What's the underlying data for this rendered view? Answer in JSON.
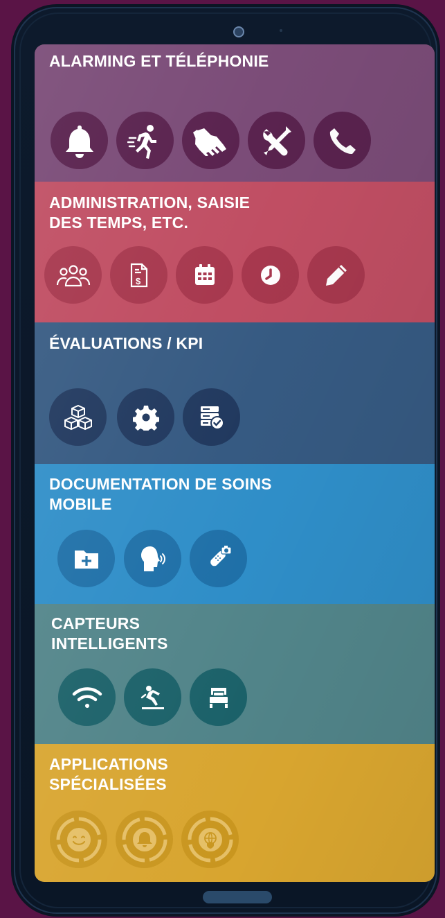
{
  "colors": {
    "background": "#5a1446",
    "alarming": "#7b4c78",
    "administration": "#c04e63",
    "evaluations": "#365a82",
    "documentation": "#2f8ec8",
    "capteurs": "#518489",
    "applications": "#d8a52f"
  },
  "sections": [
    {
      "id": "alarming",
      "title": "ALARMING ET TÉLÉPHONIE",
      "icons": [
        "bell-icon",
        "running-person-icon",
        "handshake-icon",
        "tools-icon",
        "phone-icon"
      ]
    },
    {
      "id": "administration",
      "title": "ADMINISTRATION, SAISIE\nDES TEMPS, ETC.",
      "icons": [
        "users-icon",
        "invoice-icon",
        "calendar-icon",
        "clock-icon",
        "pencil-icon"
      ]
    },
    {
      "id": "evaluations",
      "title": "ÉVALUATIONS / KPI",
      "icons": [
        "cubes-icon",
        "gear-icon",
        "server-check-icon"
      ]
    },
    {
      "id": "documentation",
      "title": "DOCUMENTATION DE SOINS\nMOBILE",
      "icons": [
        "folder-plus-icon",
        "voice-icon",
        "bandage-camera-icon"
      ]
    },
    {
      "id": "capteurs",
      "title": "CAPTEURS\nINTELLIGENTS",
      "icons": [
        "wifi-icon",
        "fall-detection-icon",
        "bed-icon"
      ]
    },
    {
      "id": "applications",
      "title": "APPLICATIONS\nSPÉCIALISÉES",
      "icons": [
        "smile-icon",
        "bell-target-icon",
        "globe-shield-icon"
      ]
    }
  ]
}
